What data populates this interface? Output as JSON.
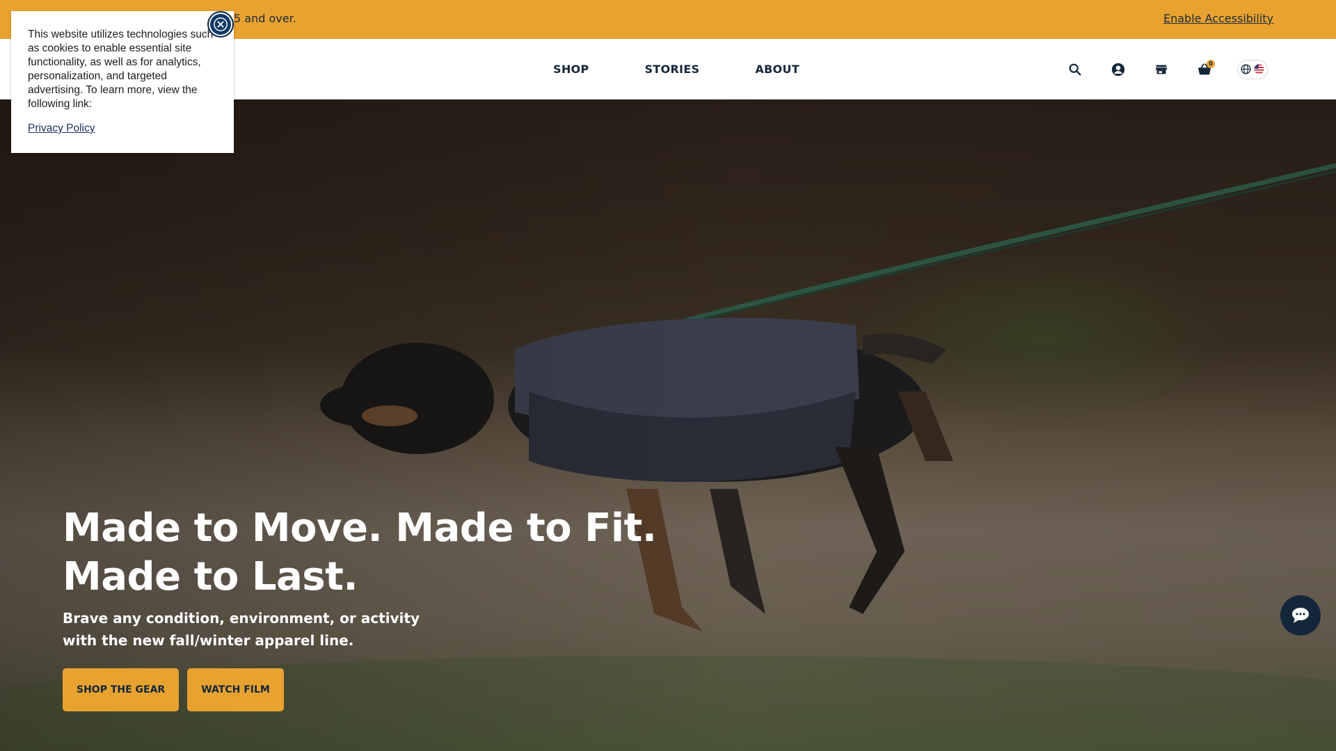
{
  "promo": {
    "text": "5 and over.",
    "accessibility_label": "Enable Accessibility"
  },
  "nav": {
    "items": [
      {
        "label": "SHOP"
      },
      {
        "label": "STORIES"
      },
      {
        "label": "ABOUT"
      }
    ],
    "icons": [
      "search-icon",
      "account-icon",
      "store-icon",
      "cart-icon",
      "globe-icon",
      "us-flag-icon"
    ],
    "cart_count": "0"
  },
  "hero": {
    "title_line1": "Made to Move. Made to Fit.",
    "title_line2": "Made to Last.",
    "subtitle": "Brave any condition, environment, or activity with the new fall/winter apparel line.",
    "buttons": [
      {
        "label": "SHOP THE GEAR"
      },
      {
        "label": "WATCH FILM"
      }
    ]
  },
  "cookie": {
    "text": "This website utilizes technologies such as cookies to enable essential site functionality, as well as for analytics, personalization, and targeted advertising. To learn more, view the following link:",
    "link_label": "Privacy Policy"
  },
  "colors": {
    "accent": "#e8a22f",
    "navy": "#14263a",
    "white": "#ffffff"
  }
}
